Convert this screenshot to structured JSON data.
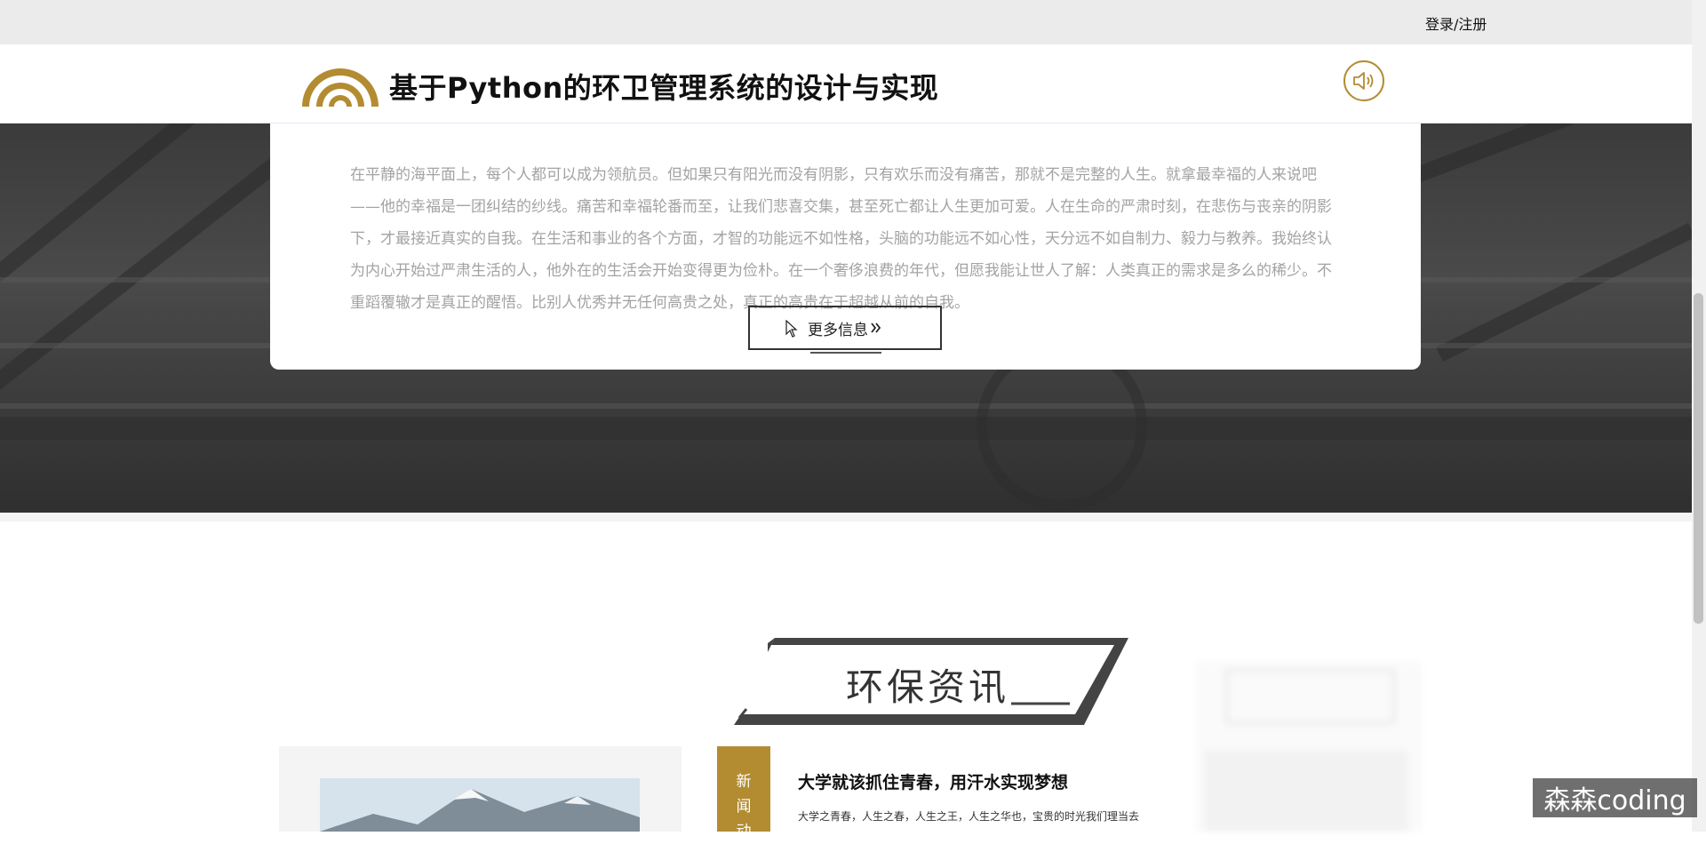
{
  "topbar": {
    "login_label": "登录/注册"
  },
  "header": {
    "title": "基于Python的环卫管理系统的设计与实现",
    "accent_color": "#b38c32"
  },
  "intro": {
    "text": "在平静的海平面上，每个人都可以成为领航员。但如果只有阳光而没有阴影，只有欢乐而没有痛苦，那就不是完整的人生。就拿最幸福的人来说吧——他的幸福是一团纠结的纱线。痛苦和幸福轮番而至，让我们悲喜交集，甚至死亡都让人生更加可爱。人在生命的严肃时刻，在悲伤与丧亲的阴影下，才最接近真实的自我。在生活和事业的各个方面，才智的功能远不如性格，头脑的功能远不如心性，天分远不如自制力、毅力与教养。我始终认为内心开始过严肃生活的人，他外在的生活会开始变得更为俭朴。在一个奢侈浪费的年代，但愿我能让世人了解：人类真正的需求是多么的稀少。不重蹈覆辙才是真正的醒悟。比别人优秀并无任何高贵之处，真正的高贵在于超越从前的自我。",
    "more_label": "更多信息"
  },
  "section": {
    "title": "环保资讯"
  },
  "news": {
    "tag_chars": [
      "新",
      "闻",
      "动"
    ],
    "title": "大学就该抓住青春，用汗水实现梦想",
    "summary": "大学之青春，人生之春，人生之王，人生之华也，宝贵的时光我们理当去"
  },
  "watermark": {
    "text": "森森coding"
  },
  "icons": {
    "logo": "arc-logo",
    "sound": "speaker-icon",
    "cursor": "mouse-pointer-icon",
    "more": "double-chevron-right-icon"
  }
}
